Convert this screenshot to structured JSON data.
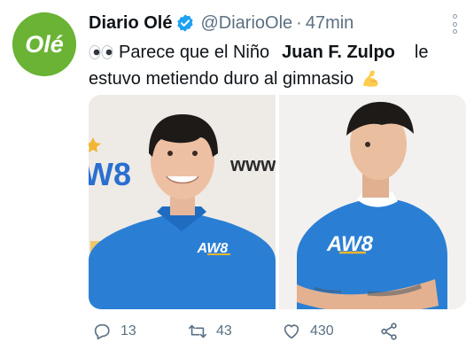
{
  "author": {
    "display_name": "Diario Olé",
    "handle": "@DiarioOle",
    "separator": "·",
    "time": "47min",
    "avatar_text": "Olé",
    "verified": true
  },
  "tweet": {
    "line1_before": "Parece que el Niño",
    "line1_bold": "Juan F. Zulpo",
    "line1_after": "le",
    "line2": "estuvo metiendo duro al gimnasio",
    "emoji_start": "eyes-icon",
    "emoji_end": "flexed-biceps-icon"
  },
  "media": {
    "photos": [
      {
        "shirt_logo": "AW8",
        "backdrop_text_left": "W8",
        "backdrop_text_right": "www."
      },
      {
        "shirt_logo": "AW8"
      }
    ]
  },
  "actions": {
    "reply_count": "13",
    "retweet_count": "43",
    "like_count": "430"
  },
  "colors": {
    "brand_green": "#6ab335",
    "verified_blue": "#1da1f2",
    "muted_text": "#5b7083",
    "shirt_blue": "#2a7fd4",
    "logo_gold": "#f2b632"
  }
}
